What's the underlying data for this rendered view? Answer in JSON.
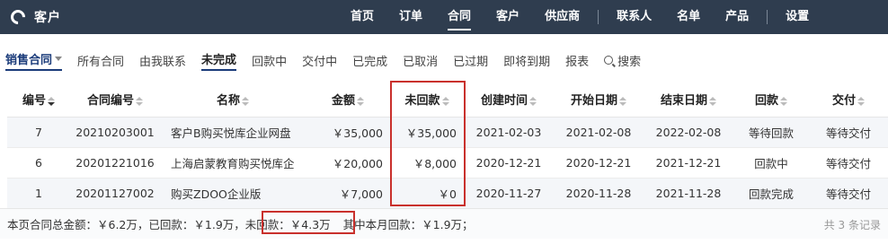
{
  "header": {
    "app_title": "客户",
    "nav": [
      {
        "label": "首页"
      },
      {
        "label": "订单"
      },
      {
        "label": "合同"
      },
      {
        "label": "客户"
      },
      {
        "label": "供应商"
      },
      {
        "label": "联系人"
      },
      {
        "label": "名单"
      },
      {
        "label": "产品"
      },
      {
        "label": "设置"
      }
    ],
    "active_nav": "合同"
  },
  "subnav": {
    "items": [
      {
        "label": "销售合同"
      },
      {
        "label": "所有合同"
      },
      {
        "label": "由我联系"
      },
      {
        "label": "未完成"
      },
      {
        "label": "回款中"
      },
      {
        "label": "交付中"
      },
      {
        "label": "已完成"
      },
      {
        "label": "已取消"
      },
      {
        "label": "已过期"
      },
      {
        "label": "即将到期"
      },
      {
        "label": "报表"
      }
    ],
    "search_label": "搜索"
  },
  "table": {
    "columns": [
      "编号",
      "合同编号",
      "名称",
      "金额",
      "未回款",
      "创建时间",
      "开始日期",
      "结束日期",
      "回款",
      "交付"
    ],
    "rows": [
      {
        "id": "7",
        "code": "20210203001",
        "name": "客户B购买悦库企业网盘",
        "amount": "￥35,000",
        "unpaid": "￥35,000",
        "created": "2021-02-03",
        "start": "2021-02-08",
        "end": "2022-02-08",
        "payment": "等待回款",
        "delivery": "等待交付"
      },
      {
        "id": "6",
        "code": "20201221016",
        "name": "上海启蒙教育购买悦库企",
        "amount": "￥20,000",
        "unpaid": "￥8,000",
        "created": "2020-12-21",
        "start": "2020-12-21",
        "end": "2021-12-21",
        "payment": "回款中",
        "delivery": "等待交付"
      },
      {
        "id": "1",
        "code": "20201127002",
        "name": "购买ZDOO企业版",
        "amount": "￥7,000",
        "unpaid": "￥0",
        "created": "2020-11-27",
        "start": "2020-11-28",
        "end": "2021-11-28",
        "payment": "回款完成",
        "delivery": "等待交付"
      }
    ]
  },
  "summary": {
    "total": "本页合同总金额：￥6.2万，",
    "paid": "已回款：￥1.9万，",
    "unpaid": "未回款：￥4.3万",
    "month": "其中本月回款：￥1.9万；"
  },
  "record_count": "共 3 条记录",
  "colors": {
    "header_bg": "#2f3d4f",
    "highlight": "#c9302c",
    "accent": "#1a3b7a"
  }
}
